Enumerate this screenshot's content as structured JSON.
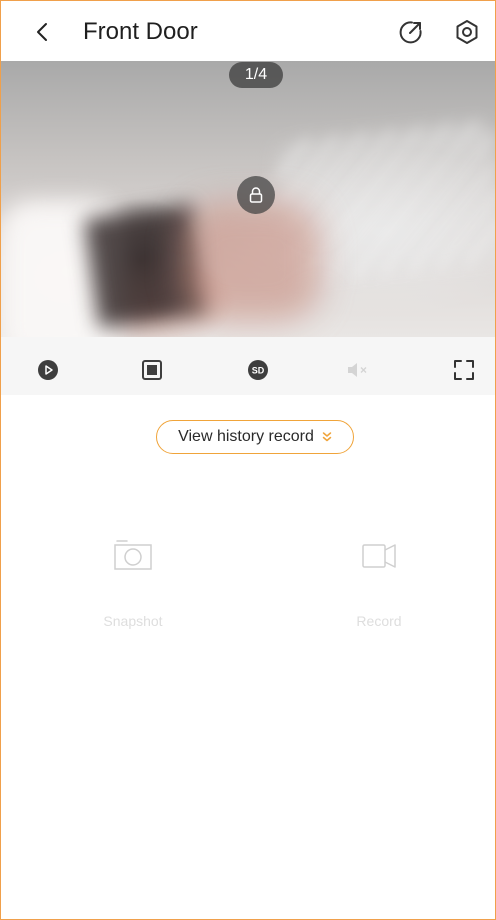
{
  "header": {
    "title": "Front Door",
    "back_icon": "chevron-left-icon",
    "share_icon": "share-icon",
    "settings_icon": "gear-icon"
  },
  "video": {
    "page_indicator": "1/4",
    "lock_icon": "lock-icon"
  },
  "controls": [
    {
      "name": "play-icon"
    },
    {
      "name": "stop-square-icon"
    },
    {
      "name": "sd-quality-icon",
      "text": "SD"
    },
    {
      "name": "mute-icon"
    },
    {
      "name": "fullscreen-icon"
    }
  ],
  "history": {
    "label": "View history record",
    "icon": "double-chevron-down-icon"
  },
  "actions": {
    "snapshot_label": "Snapshot",
    "record_label": "Record"
  },
  "colors": {
    "accent": "#f0a43a",
    "frame": "#f0a04b",
    "disabled_text": "#dedede"
  }
}
